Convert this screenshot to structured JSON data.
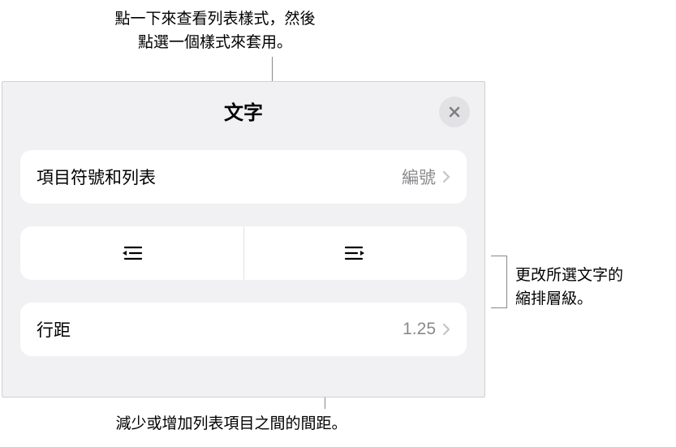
{
  "callouts": {
    "top": "點一下來查看列表樣式，然後\n點選一個樣式來套用。",
    "right": "更改所選文字的\n縮排層級。",
    "bottom": "減少或增加列表項目之間的間距。"
  },
  "panel": {
    "title": "文字",
    "rows": {
      "bullets": {
        "label": "項目符號和列表",
        "value": "編號"
      },
      "lineSpacing": {
        "label": "行距",
        "value": "1.25"
      }
    }
  }
}
